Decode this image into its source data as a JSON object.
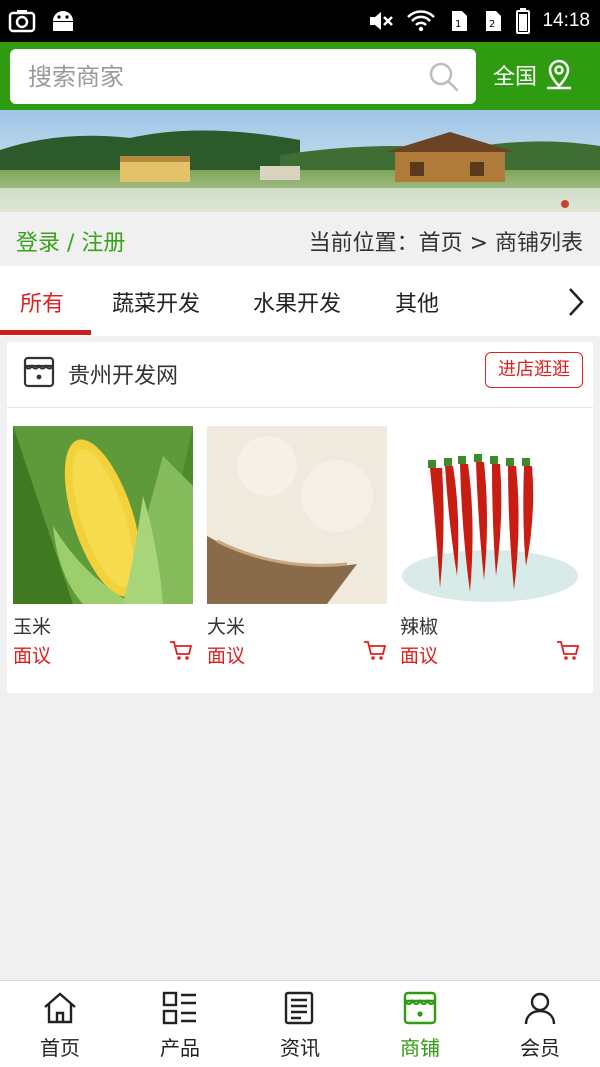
{
  "status_bar": {
    "time": "14:18"
  },
  "search": {
    "placeholder": "搜索商家",
    "region_label": "全国"
  },
  "breadcrumb": {
    "login_label": "登录 / 注册",
    "location": "当前位置：首页 > 商铺列表"
  },
  "tabs": [
    {
      "label": "所有",
      "active": true
    },
    {
      "label": "蔬菜开发",
      "active": false
    },
    {
      "label": "水果开发",
      "active": false
    },
    {
      "label": "其他",
      "active": false
    }
  ],
  "shop": {
    "name": "贵州开发网",
    "enter_label": "进店逛逛",
    "products": [
      {
        "name": "玉米",
        "price": "面议",
        "image": "corn"
      },
      {
        "name": "大米",
        "price": "面议",
        "image": "rice"
      },
      {
        "name": "辣椒",
        "price": "面议",
        "image": "chili"
      }
    ]
  },
  "bottom_nav": [
    {
      "label": "首页",
      "icon": "home-icon",
      "active": false
    },
    {
      "label": "产品",
      "icon": "list-icon",
      "active": false
    },
    {
      "label": "资讯",
      "icon": "news-icon",
      "active": false
    },
    {
      "label": "商铺",
      "icon": "store-icon",
      "active": true
    },
    {
      "label": "会员",
      "icon": "user-icon",
      "active": false
    }
  ],
  "colors": {
    "brand_green": "#2e9b11",
    "accent_red": "#e02020"
  }
}
